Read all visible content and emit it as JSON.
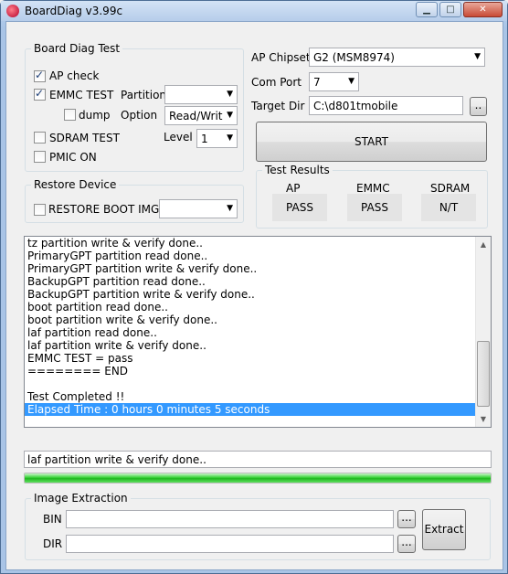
{
  "window": {
    "title": "BoardDiag v3.99c"
  },
  "board_diag_test": {
    "title": "Board Diag Test",
    "ap_check": {
      "label": "AP check",
      "checked": true
    },
    "emmc_test": {
      "label": "EMMC TEST",
      "checked": true
    },
    "partition": {
      "label": "Partition",
      "value": ""
    },
    "dump": {
      "label": "dump",
      "checked": false
    },
    "option": {
      "label": "Option",
      "value": "Read/Writ"
    },
    "sdram_test": {
      "label": "SDRAM TEST",
      "checked": false
    },
    "level": {
      "label": "Level",
      "value": "1"
    },
    "pmic_on": {
      "label": "PMIC ON",
      "checked": false
    }
  },
  "restore_device": {
    "title": "Restore Device",
    "restore_boot_img": {
      "label": "RESTORE BOOT IMG",
      "checked": false
    },
    "combo_value": ""
  },
  "ap_chipset": {
    "label": "AP Chipset",
    "value": "G2 (MSM8974)"
  },
  "com_port": {
    "label": "Com Port",
    "value": "7"
  },
  "target_dir": {
    "label": "Target Dir",
    "value": "C:\\d801tmobile",
    "browse": ".."
  },
  "start_button": "START",
  "test_results": {
    "title": "Test Results",
    "items": [
      {
        "name": "AP",
        "value": "PASS"
      },
      {
        "name": "EMMC",
        "value": "PASS"
      },
      {
        "name": "SDRAM",
        "value": "N/T"
      }
    ]
  },
  "log": {
    "lines": [
      "tz partition write & verify done..",
      "PrimaryGPT partition read done..",
      "PrimaryGPT partition write & verify done..",
      "BackupGPT partition read done..",
      "BackupGPT partition write & verify done..",
      "boot partition read done..",
      "boot partition write & verify done..",
      "laf partition read done..",
      "laf partition write & verify done..",
      "EMMC TEST = pass",
      "======== END",
      "",
      "Test Completed !!",
      "Elapsed Time : 0 hours 0 minutes 5 seconds"
    ],
    "selected_index": 13
  },
  "status_text": "laf partition write & verify done..",
  "progress": {
    "percent": 100,
    "color": "#2fc82f"
  },
  "image_extraction": {
    "title": "Image Extraction",
    "bin_label": "BIN",
    "bin_value": "",
    "dir_label": "DIR",
    "dir_value": "",
    "browse": "...",
    "extract_button": "Extract"
  }
}
